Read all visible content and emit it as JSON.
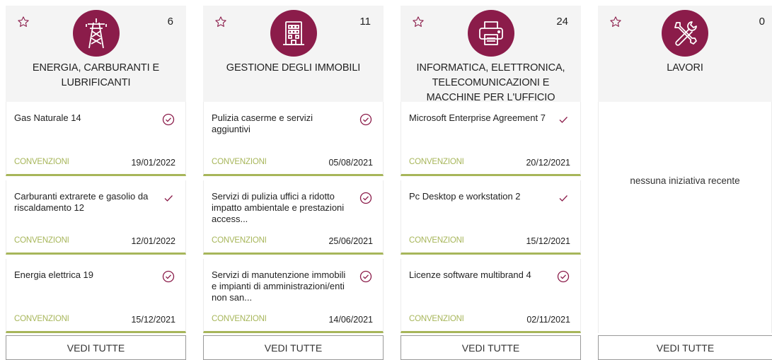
{
  "categories": [
    {
      "icon": "power-tower-icon",
      "count": "6",
      "title": "ENERGIA, CARBURANTI E LUBRIFICANTI",
      "items": [
        {
          "title": "Gas Naturale 14",
          "status": "check-circle-icon",
          "type": "CONVENZIONI",
          "date": "19/01/2022"
        },
        {
          "title": "Carburanti extrarete e gasolio da riscaldamento 12",
          "status": "check-icon",
          "type": "CONVENZIONI",
          "date": "12/01/2022"
        },
        {
          "title": "Energia elettrica 19",
          "status": "check-circle-icon",
          "type": "CONVENZIONI",
          "date": "15/12/2021"
        }
      ],
      "button": "VEDI TUTTE"
    },
    {
      "icon": "building-icon",
      "count": "11",
      "title": "GESTIONE DEGLI IMMOBILI",
      "items": [
        {
          "title": "Pulizia caserme e servizi aggiuntivi",
          "status": "check-circle-icon",
          "type": "CONVENZIONI",
          "date": "05/08/2021"
        },
        {
          "title": "Servizi di pulizia uffici a ridotto impatto ambientale e prestazioni access...",
          "status": "check-circle-icon",
          "type": "CONVENZIONI",
          "date": "25/06/2021"
        },
        {
          "title": "Servizi di manutenzione immobili e impianti di amministrazioni/enti non san...",
          "status": "check-circle-icon",
          "type": "CONVENZIONI",
          "date": "14/06/2021"
        }
      ],
      "button": "VEDI TUTTE"
    },
    {
      "icon": "printer-icon",
      "count": "24",
      "title": "INFORMATICA, ELETTRONICA, TELECOMUNICAZIONI E MACCHINE PER L'UFFICIO",
      "items": [
        {
          "title": "Microsoft Enterprise Agreement 7",
          "status": "check-icon",
          "type": "CONVENZIONI",
          "date": "20/12/2021"
        },
        {
          "title": "Pc Desktop e workstation 2",
          "status": "check-icon",
          "type": "CONVENZIONI",
          "date": "15/12/2021"
        },
        {
          "title": "Licenze software multibrand 4",
          "status": "check-circle-icon",
          "type": "CONVENZIONI",
          "date": "02/11/2021"
        }
      ],
      "button": "VEDI TUTTE"
    },
    {
      "icon": "tools-icon",
      "count": "0",
      "title": "LAVORI",
      "empty_text": "nessuna iniziativa recente",
      "button": "VEDI TUTTE"
    }
  ],
  "colors": {
    "brand": "#8b1c4a",
    "accent_green": "#a7b65a",
    "header_bg": "#f4f4f4"
  }
}
